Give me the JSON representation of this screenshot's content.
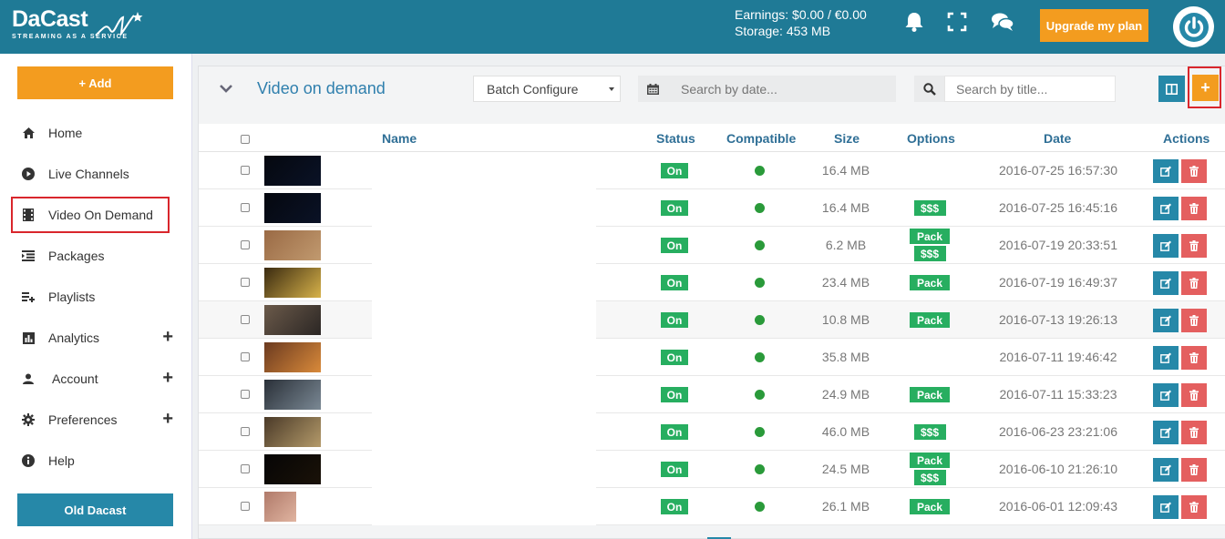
{
  "header": {
    "logo": "DaCast",
    "logo_tagline": "STREAMING AS A SERVICE",
    "earnings": "Earnings: $0.00 / €0.00",
    "storage": "Storage: 453 MB",
    "upgrade_label": "Upgrade my plan",
    "icons": [
      "bell-icon",
      "fullscreen-icon",
      "chat-icon",
      "power-icon"
    ]
  },
  "sidebar": {
    "add_label": "+ Add",
    "items": [
      {
        "label": "Home",
        "icon": "home-icon"
      },
      {
        "label": "Live Channels",
        "icon": "play-circle-icon"
      },
      {
        "label": "Video On Demand",
        "icon": "film-icon",
        "selected": true
      },
      {
        "label": "Packages",
        "icon": "list-indent-icon"
      },
      {
        "label": "Playlists",
        "icon": "playlist-add-icon"
      },
      {
        "label": "Analytics",
        "icon": "bar-chart-icon",
        "expandable": true
      },
      {
        "label": "Account",
        "icon": "user-icon",
        "expandable": true
      },
      {
        "label": "Preferences",
        "icon": "gear-icon",
        "expandable": true
      },
      {
        "label": "Help",
        "icon": "info-icon"
      }
    ],
    "old_label": "Old Dacast"
  },
  "panel": {
    "title": "Video on demand",
    "batch_label": "Batch Configure",
    "date_placeholder": "Search by date...",
    "title_placeholder": "Search by title...",
    "plus_label": "+"
  },
  "table": {
    "columns": [
      "Name",
      "Status",
      "Compatible",
      "Size",
      "Options",
      "Date",
      "Actions"
    ],
    "rows": [
      {
        "status": "On",
        "size": "16.4 MB",
        "options": [],
        "date": "2016-07-25 16:57:30"
      },
      {
        "status": "On",
        "size": "16.4 MB",
        "options": [
          "$$$"
        ],
        "date": "2016-07-25 16:45:16"
      },
      {
        "status": "On",
        "size": "6.2 MB",
        "options": [
          "Pack",
          "$$$"
        ],
        "date": "2016-07-19 20:33:51"
      },
      {
        "status": "On",
        "size": "23.4 MB",
        "options": [
          "Pack"
        ],
        "date": "2016-07-19 16:49:37"
      },
      {
        "status": "On",
        "size": "10.8 MB",
        "options": [
          "Pack"
        ],
        "date": "2016-07-13 19:26:13"
      },
      {
        "status": "On",
        "size": "35.8 MB",
        "options": [],
        "date": "2016-07-11 19:46:42"
      },
      {
        "status": "On",
        "size": "24.9 MB",
        "options": [
          "Pack"
        ],
        "date": "2016-07-11 15:33:23"
      },
      {
        "status": "On",
        "size": "46.0 MB",
        "options": [
          "$$$"
        ],
        "date": "2016-06-23 23:21:06"
      },
      {
        "status": "On",
        "size": "24.5 MB",
        "options": [
          "Pack",
          "$$$"
        ],
        "date": "2016-06-10 21:26:10"
      },
      {
        "status": "On",
        "size": "26.1 MB",
        "options": [
          "Pack"
        ],
        "date": "2016-06-01 12:09:43"
      }
    ]
  },
  "colors": {
    "topbar": "#1f7a96",
    "accent_orange": "#f39c1f",
    "primary_blue": "#2688a8",
    "danger_red": "#e45f5f",
    "success_green": "#27ae60",
    "highlight_red": "#d9262c"
  }
}
